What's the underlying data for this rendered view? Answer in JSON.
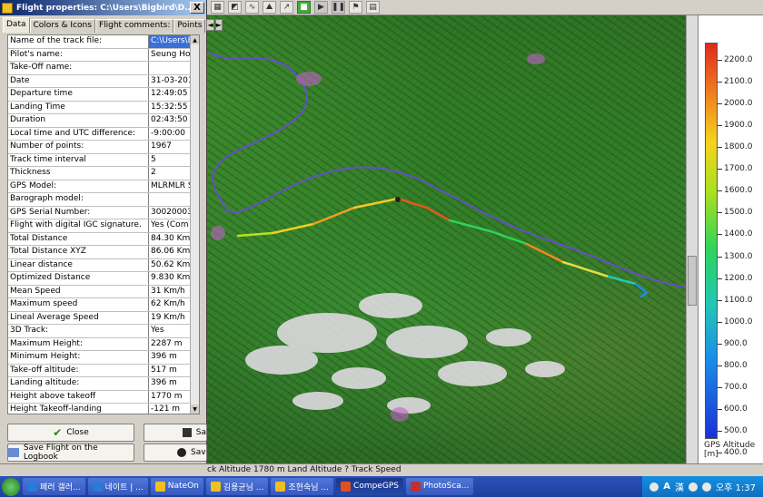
{
  "toolbar": {
    "icons": [
      "map-icon",
      "satellite-icon",
      "track-icon",
      "profile-icon",
      "graph-icon",
      "play-icon",
      "play-icon-2",
      "pause-icon",
      "flag-icon",
      "settings-icon"
    ]
  },
  "dialog": {
    "title": "Flight properties: C:\\Users\\Bigbird\\D...",
    "close_label": "X",
    "tabs": [
      {
        "label": "Data",
        "active": true
      },
      {
        "label": "Colors & Icons",
        "active": false
      },
      {
        "label": "Flight comments:",
        "active": false
      },
      {
        "label": "Points",
        "active": false
      }
    ],
    "tab_prev": "◄",
    "tab_next": "►",
    "rows": [
      {
        "key": "Name of the track file:",
        "value": "C:\\Users\\B",
        "selected": true
      },
      {
        "key": "Pilot's name:",
        "value": "Seung Ho \\"
      },
      {
        "key": "Take-Off name:",
        "value": ""
      },
      {
        "key": "Date",
        "value": "31-03-2014"
      },
      {
        "key": "Departure time",
        "value": "12:49:05"
      },
      {
        "key": "Landing Time",
        "value": "15:32:55"
      },
      {
        "key": "Duration",
        "value": "02:43:50"
      },
      {
        "key": "Local time and UTC difference:",
        "value": "-9:00:00"
      },
      {
        "key": "Number of points:",
        "value": "1967"
      },
      {
        "key": "Track time interval",
        "value": "5"
      },
      {
        "key": "Thickness",
        "value": "2"
      },
      {
        "key": "GPS Model:",
        "value": "MLRMLR  S"
      },
      {
        "key": "Barograph model:",
        "value": ""
      },
      {
        "key": "GPS Serial Number:",
        "value": "300200030"
      },
      {
        "key": "Flight with digital IGC signature.",
        "value": "Yes    (Com"
      },
      {
        "key": "Total Distance",
        "value": "84.30 Km"
      },
      {
        "key": "Total Distance XYZ",
        "value": "86.06 Km"
      },
      {
        "key": "Linear distance",
        "value": "50.62 Km"
      },
      {
        "key": "Optimized Distance",
        "value": "9.830 Km"
      },
      {
        "key": "Mean Speed",
        "value": "31 Km/h"
      },
      {
        "key": "Maximum speed",
        "value": "62 Km/h"
      },
      {
        "key": "Lineal Average Speed",
        "value": "19 Km/h"
      },
      {
        "key": "3D Track:",
        "value": "Yes"
      },
      {
        "key": "Maximum Height:",
        "value": "2287 m"
      },
      {
        "key": "Minimum Height:",
        "value": "396 m"
      },
      {
        "key": "Take-off altitude:",
        "value": "517 m"
      },
      {
        "key": "Landing altitude:",
        "value": "396 m"
      },
      {
        "key": "Height above takeoff",
        "value": "1770 m"
      },
      {
        "key": "Height Takeoff-landing",
        "value": "-121 m"
      }
    ],
    "buttons": {
      "close": "Close",
      "save_right": "Sa",
      "save_logbook": "Save Flight on the Logbook",
      "save_right2": "Sav"
    }
  },
  "color_scale": {
    "labels": [
      "2200.0",
      "2100.0",
      "2000.0",
      "1900.0",
      "1800.0",
      "1700.0",
      "1600.0",
      "1500.0",
      "1400.0",
      "1300.0",
      "1200.0",
      "1100.0",
      "1000.0",
      "900.0",
      "800.0",
      "700.0",
      "600.0",
      "500.0",
      "400.0"
    ],
    "title": "GPS Altitude",
    "unit": "[m]"
  },
  "status_bar": {
    "text": "ck Altitude 1780 m Land Altitude ? Track Speed"
  },
  "taskbar": {
    "items": [
      {
        "label": "페러 갤러...",
        "icon_color": "#2a7ad8",
        "active": false
      },
      {
        "label": "네이트 | ...",
        "icon_color": "#2a7ad8",
        "active": false
      },
      {
        "label": "NateOn",
        "icon_color": "#f0c020",
        "active": false
      },
      {
        "label": "김용균님 ...",
        "icon_color": "#f0c020",
        "active": false
      },
      {
        "label": "조현숙님 ...",
        "icon_color": "#f0c020",
        "active": false
      },
      {
        "label": "CompeGPS",
        "icon_color": "#e05020",
        "active": true
      },
      {
        "label": "PhotoSca...",
        "icon_color": "#c03030",
        "active": false
      }
    ],
    "tray": {
      "ime_label": "A",
      "hanja_label": "漢",
      "clock": "오후 1:37"
    }
  }
}
